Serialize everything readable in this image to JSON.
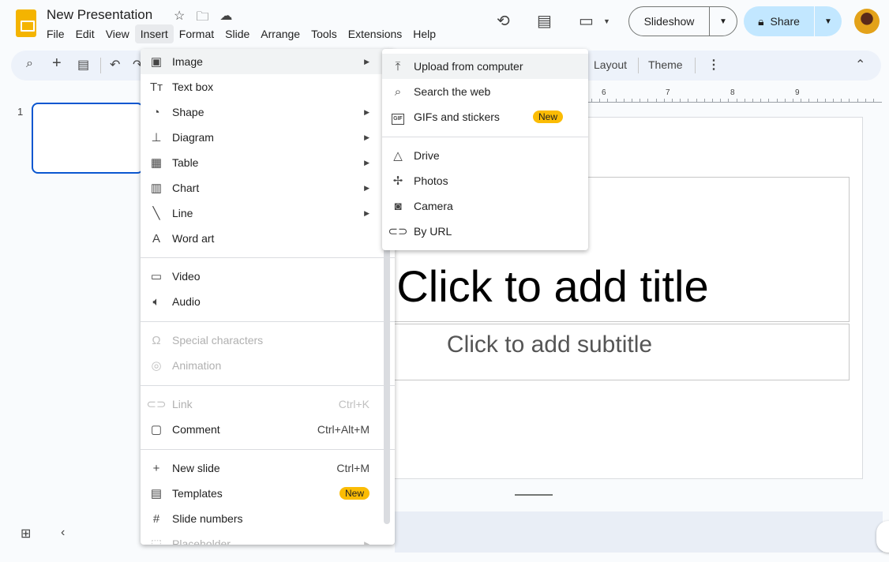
{
  "app": {
    "title": "New Presentation",
    "brand_color": "#f4b400"
  },
  "menubar": [
    "File",
    "Edit",
    "View",
    "Insert",
    "Format",
    "Slide",
    "Arrange",
    "Tools",
    "Extensions",
    "Help"
  ],
  "menubar_active": "Insert",
  "header": {
    "slideshow_label": "Slideshow",
    "share_label": "Share",
    "share_color": "#c2e7ff"
  },
  "toolbar": {
    "layout_label": "Layout",
    "theme_label": "Theme"
  },
  "ruler": [
    "6",
    "7",
    "8",
    "9"
  ],
  "filmstrip": {
    "slide_number": "1"
  },
  "slide": {
    "title_placeholder": "Click to add title",
    "subtitle_placeholder": "Click to add subtitle"
  },
  "insert_menu": {
    "items": [
      {
        "label": "Image",
        "icon": "image-icon",
        "submenu": true,
        "highlighted": true
      },
      {
        "label": "Text box",
        "icon": "text-box-icon"
      },
      {
        "label": "Shape",
        "icon": "shape-icon",
        "submenu": true
      },
      {
        "label": "Diagram",
        "icon": "diagram-icon",
        "submenu": true
      },
      {
        "label": "Table",
        "icon": "table-icon",
        "submenu": true
      },
      {
        "label": "Chart",
        "icon": "chart-icon",
        "submenu": true
      },
      {
        "label": "Line",
        "icon": "line-icon",
        "submenu": true
      },
      {
        "label": "Word art",
        "icon": "word-art-icon"
      },
      {
        "label": "Video",
        "icon": "video-icon"
      },
      {
        "label": "Audio",
        "icon": "audio-icon"
      },
      {
        "label": "Special characters",
        "icon": "omega-icon",
        "disabled": true
      },
      {
        "label": "Animation",
        "icon": "animation-icon",
        "disabled": true
      },
      {
        "label": "Link",
        "icon": "link-icon",
        "shortcut": "Ctrl+K",
        "disabled": true
      },
      {
        "label": "Comment",
        "icon": "comment-icon",
        "shortcut": "Ctrl+Alt+M"
      },
      {
        "label": "New slide",
        "icon": "plus-icon",
        "shortcut": "Ctrl+M"
      },
      {
        "label": "Templates",
        "icon": "templates-icon",
        "badge": "New"
      },
      {
        "label": "Slide numbers",
        "icon": "hash-icon"
      },
      {
        "label": "Placeholder",
        "icon": "placeholder-icon",
        "submenu": true,
        "disabled": true
      }
    ]
  },
  "image_submenu": {
    "items": [
      {
        "label": "Upload from computer",
        "icon": "upload-icon",
        "highlighted": true
      },
      {
        "label": "Search the web",
        "icon": "search-icon"
      },
      {
        "label": "GIFs and stickers",
        "icon": "gif-icon",
        "badge": "New",
        "icon_text": "GIF"
      },
      {
        "label": "Drive",
        "icon": "drive-icon"
      },
      {
        "label": "Photos",
        "icon": "photos-icon"
      },
      {
        "label": "Camera",
        "icon": "camera-icon"
      },
      {
        "label": "By URL",
        "icon": "link-icon"
      }
    ]
  }
}
